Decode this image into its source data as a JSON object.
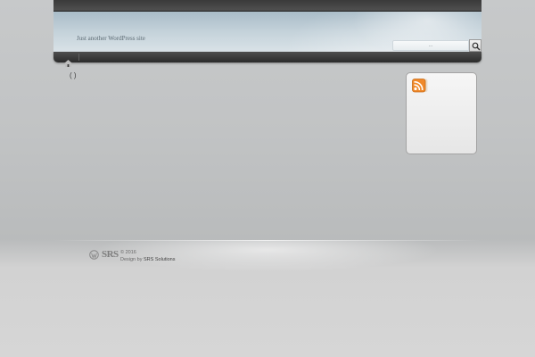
{
  "header": {
    "tagline": "Just another WordPress site",
    "search": {
      "value": "...",
      "button_icon": "search-icon"
    }
  },
  "nav": {
    "home_icon": "home-icon"
  },
  "content": {
    "post_meta": "( )"
  },
  "sidebar": {
    "rss_icon": "rss-icon"
  },
  "footer": {
    "logo_text": "SRS",
    "copyright": "© 2016",
    "design_by_label": "Design by",
    "design_by_link": "SRS Solutions"
  },
  "colors": {
    "header_bar": "#3a3a3a",
    "header_band": "#c4d2da",
    "rss_orange": "#f0892a",
    "page_background": "#c1c3c4"
  }
}
